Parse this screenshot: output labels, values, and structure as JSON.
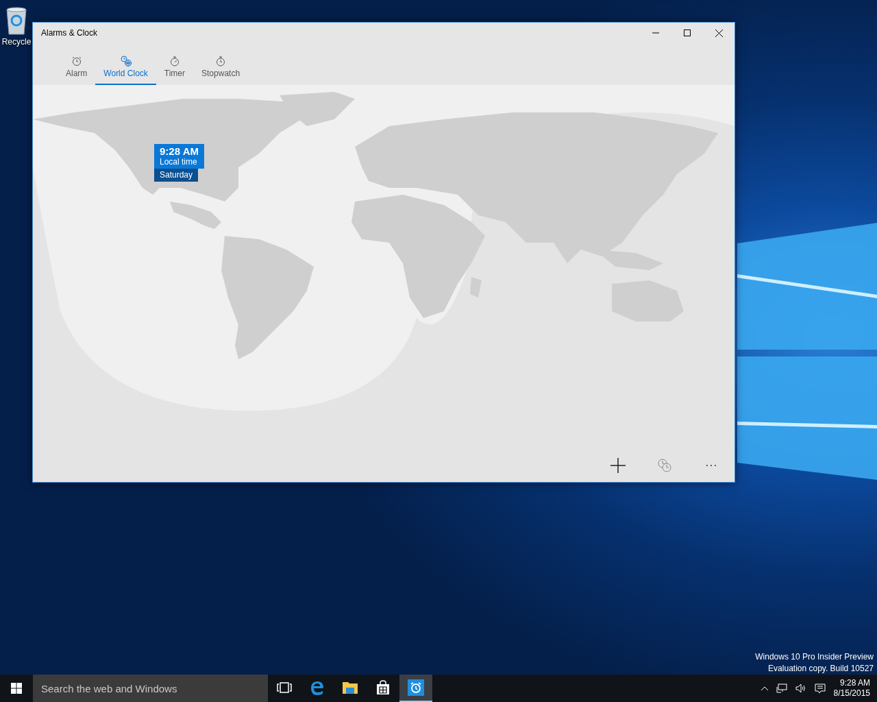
{
  "desktop": {
    "icons": [
      {
        "label": "Recycle"
      }
    ],
    "notice": [
      "Windows 10 Pro Insider Preview",
      "Evaluation copy. Build 10527"
    ]
  },
  "window": {
    "title": "Alarms & Clock",
    "tabs": [
      {
        "label": "Alarm",
        "selected": false
      },
      {
        "label": "World Clock",
        "selected": true
      },
      {
        "label": "Timer",
        "selected": false
      },
      {
        "label": "Stopwatch",
        "selected": false
      }
    ],
    "clock_card": {
      "time": "9:28 AM",
      "label": "Local time",
      "day": "Saturday"
    }
  },
  "taskbar": {
    "search": {
      "placeholder": "Search the web and Windows"
    },
    "apps": [
      {
        "kind": "task-view",
        "active": false
      },
      {
        "kind": "browser",
        "active": false
      },
      {
        "kind": "folder",
        "active": false
      },
      {
        "kind": "store",
        "active": false
      },
      {
        "kind": "alarms",
        "active": true
      }
    ],
    "tray": {
      "time": "9:28 AM",
      "date": "8/15/2015"
    }
  }
}
